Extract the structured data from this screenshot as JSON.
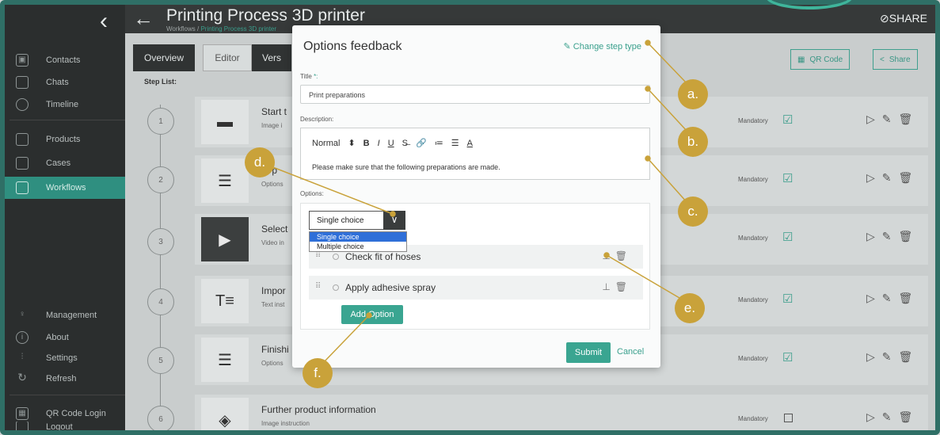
{
  "header": {
    "title": "Printing Process 3D printer",
    "breadcrumb_root": "Workflows /",
    "breadcrumb_current": "Printing Process 3D printer",
    "share_label": "SHARE"
  },
  "sidebar": {
    "items": [
      {
        "label": "Contacts",
        "icon": "contacts-icon"
      },
      {
        "label": "Chats",
        "icon": "chat-icon"
      },
      {
        "label": "Timeline",
        "icon": "clock-icon"
      },
      {
        "label": "Products",
        "icon": "product-icon"
      },
      {
        "label": "Cases",
        "icon": "case-icon"
      },
      {
        "label": "Workflows",
        "icon": "workflow-icon",
        "active": true
      },
      {
        "label": "Management",
        "icon": "bulb-icon"
      },
      {
        "label": "About",
        "icon": "info-icon"
      },
      {
        "label": "Settings",
        "icon": "sliders-icon"
      },
      {
        "label": "Refresh",
        "icon": "refresh-icon"
      },
      {
        "label": "QR Code Login",
        "icon": "qr-icon"
      },
      {
        "label": "Logout",
        "icon": "logout-icon"
      }
    ]
  },
  "tabs": [
    "Overview",
    "Editor",
    "Vers"
  ],
  "toolbar": {
    "qr_code": "QR Code",
    "share": "Share"
  },
  "step_list_label": "Step List:",
  "steps": [
    {
      "num": "1",
      "name": "Start t",
      "type": "Image i",
      "mandatory": "Mandatory",
      "checked": true
    },
    {
      "num": "2",
      "name": "nt p",
      "type": "Options",
      "mandatory": "Mandatory",
      "checked": true
    },
    {
      "num": "3",
      "name": "Select",
      "type": "Video in",
      "mandatory": "Mandatory",
      "checked": true
    },
    {
      "num": "4",
      "name": "Impor",
      "type": "Text inst",
      "mandatory": "Mandatory",
      "checked": true
    },
    {
      "num": "5",
      "name": "Finishi",
      "type": "Options",
      "mandatory": "Mandatory",
      "checked": true
    },
    {
      "num": "6",
      "name": "Further product information",
      "type": "Image instruction",
      "mandatory": "Mandatory",
      "checked": false
    }
  ],
  "dialog": {
    "title": "Options feedback",
    "change_step_type": "Change step type",
    "title_label": "Title",
    "title_required": "*:",
    "title_value": "Print preparations",
    "description_label": "Description:",
    "rte_format": "Normal",
    "description_value": "Please make sure that the following preparations are made.",
    "options_label": "Options:",
    "select_value": "Single choice",
    "dropdown_options": [
      "Single choice",
      "Multiple choice"
    ],
    "options": [
      "Check fit of hoses",
      "Apply adhesive spray"
    ],
    "add_option": "Add Option",
    "submit": "Submit",
    "cancel": "Cancel"
  },
  "callouts": [
    "a.",
    "b.",
    "c.",
    "d.",
    "e.",
    "f."
  ],
  "colors": {
    "accent": "#3aa591",
    "callout": "#c9a23a",
    "sidebar": "#2b2e2e"
  }
}
